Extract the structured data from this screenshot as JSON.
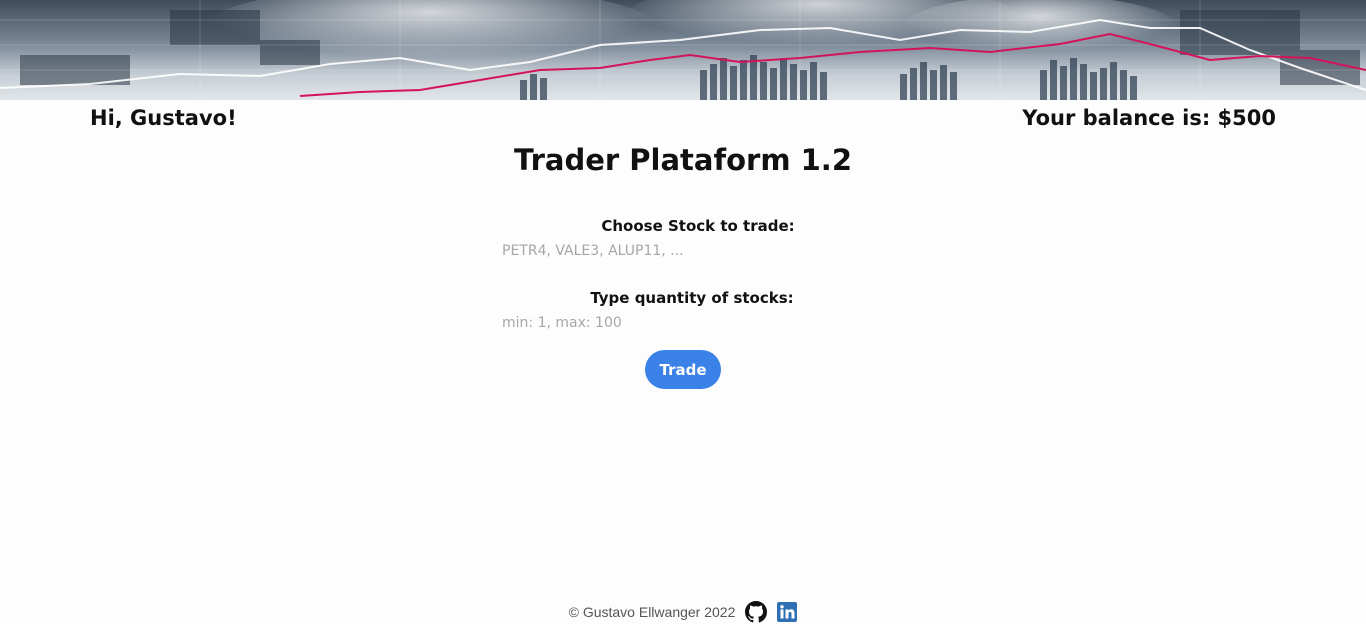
{
  "header": {
    "greeting": "Hi, Gustavo!",
    "balance": "Your balance is: $500"
  },
  "main": {
    "title": "Trader Plataform 1.2",
    "stock_label": "Choose Stock to trade:",
    "stock_placeholder": "PETR4, VALE3, ALUP11, ...",
    "quantity_label": "Type quantity of stocks:",
    "quantity_placeholder": "min: 1, max: 100",
    "trade_button": "Trade"
  },
  "footer": {
    "copyright": "© Gustavo Ellwanger 2022",
    "icons": [
      "github-icon",
      "linkedin-icon"
    ]
  },
  "colors": {
    "accent": "#3b82e8",
    "linkedin": "#2f6fb3",
    "chart_line": "#d4145a"
  }
}
